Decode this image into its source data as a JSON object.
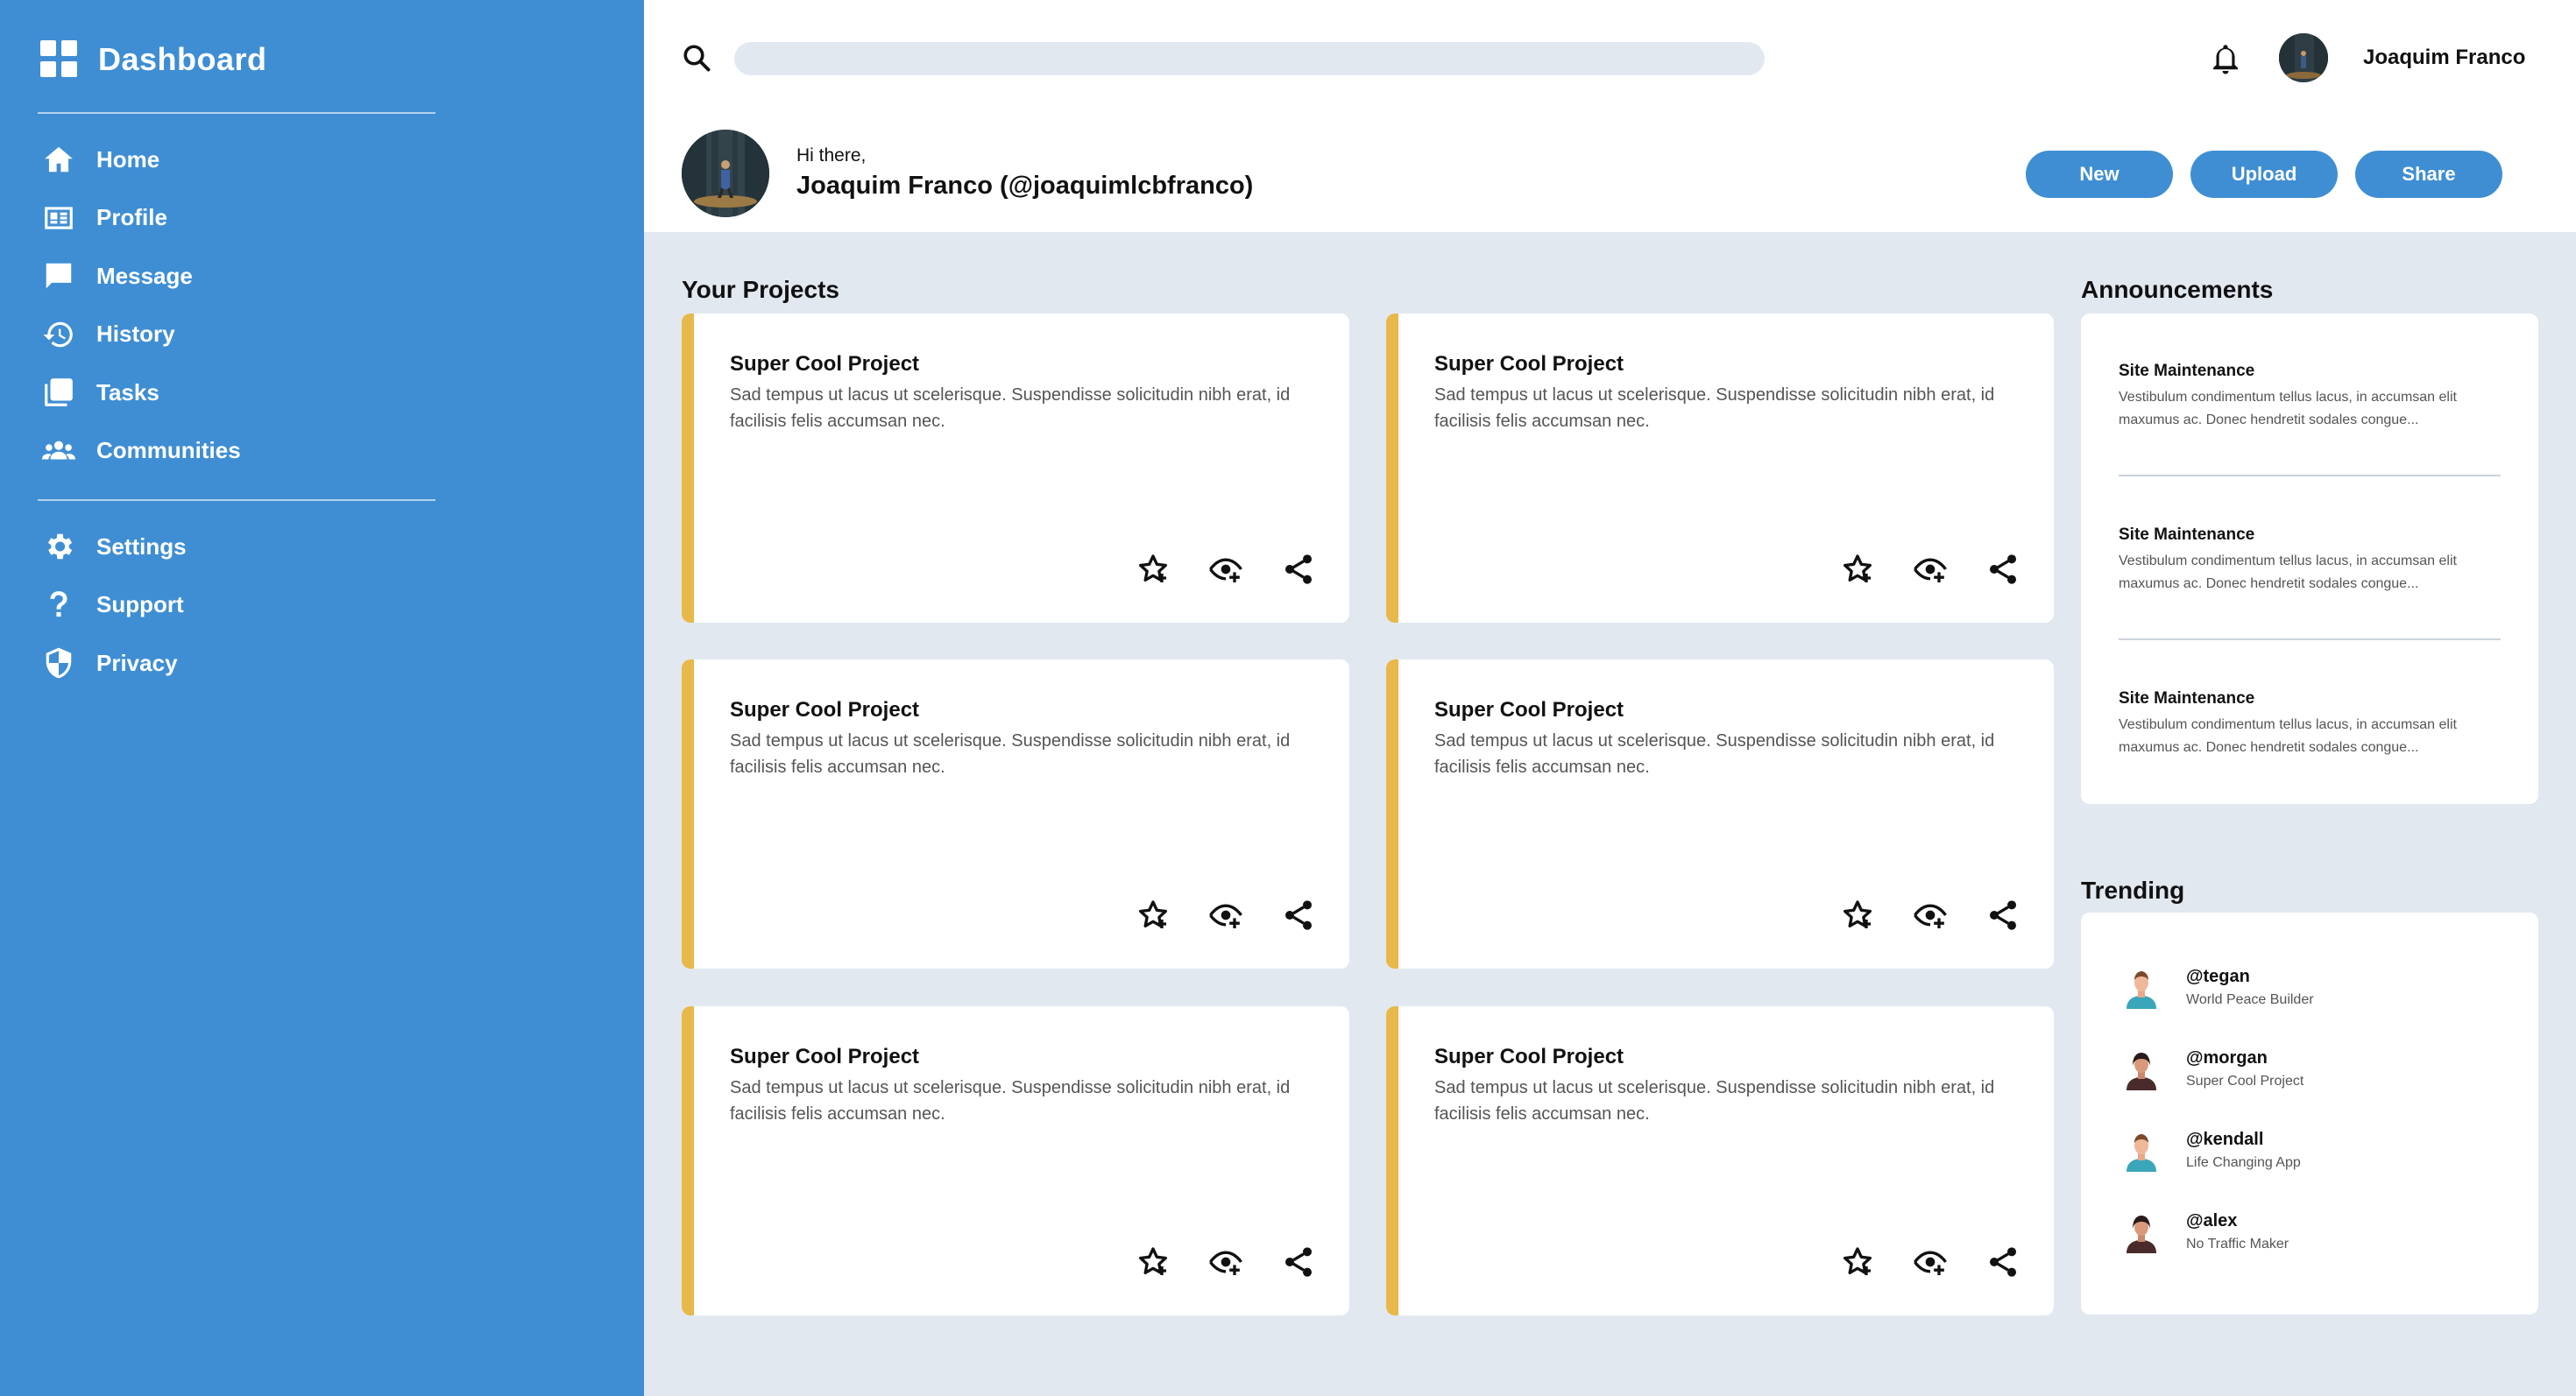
{
  "sidebar": {
    "brand": "Dashboard",
    "nav_primary": [
      {
        "label": "Home",
        "icon": "home-icon"
      },
      {
        "label": "Profile",
        "icon": "id-card-icon"
      },
      {
        "label": "Message",
        "icon": "message-icon"
      },
      {
        "label": "History",
        "icon": "history-icon"
      },
      {
        "label": "Tasks",
        "icon": "tasks-icon"
      },
      {
        "label": "Communities",
        "icon": "communities-icon"
      }
    ],
    "nav_secondary": [
      {
        "label": "Settings",
        "icon": "gear-icon"
      },
      {
        "label": "Support",
        "icon": "question-icon"
      },
      {
        "label": "Privacy",
        "icon": "shield-icon"
      }
    ]
  },
  "header": {
    "search": {
      "placeholder": "",
      "value": ""
    },
    "user_name": "Joaquim Franco",
    "greeting": "Hi there,",
    "full_name": "Joaquim Franco (@joaquimlcbfranco)",
    "buttons": {
      "new": "New",
      "upload": "Upload",
      "share": "Share"
    }
  },
  "projects": {
    "title": "Your Projects",
    "items": [
      {
        "title": "Super Cool Project",
        "description": "Sad tempus ut lacus ut scelerisque. Suspendisse solicitudin nibh erat, id facilisis felis accumsan nec."
      },
      {
        "title": "Super Cool Project",
        "description": "Sad tempus ut lacus ut scelerisque. Suspendisse solicitudin nibh erat, id facilisis felis accumsan nec."
      },
      {
        "title": "Super Cool Project",
        "description": "Sad tempus ut lacus ut scelerisque. Suspendisse solicitudin nibh erat, id facilisis felis accumsan nec."
      },
      {
        "title": "Super Cool Project",
        "description": "Sad tempus ut lacus ut scelerisque. Suspendisse solicitudin nibh erat, id facilisis felis accumsan nec."
      },
      {
        "title": "Super Cool Project",
        "description": "Sad tempus ut lacus ut scelerisque. Suspendisse solicitudin nibh erat, id facilisis felis accumsan nec."
      },
      {
        "title": "Super Cool Project",
        "description": "Sad tempus ut lacus ut scelerisque. Suspendisse solicitudin nibh erat, id facilisis felis accumsan nec."
      }
    ]
  },
  "announcements": {
    "title": "Announcements",
    "items": [
      {
        "title": "Site Maintenance",
        "text": "Vestibulum condimentum tellus lacus, in accumsan elit maxumus ac. Donec hendretit sodales congue..."
      },
      {
        "title": "Site Maintenance",
        "text": "Vestibulum condimentum tellus lacus, in accumsan elit maxumus ac. Donec hendretit sodales congue..."
      },
      {
        "title": "Site Maintenance",
        "text": "Vestibulum condimentum tellus lacus, in accumsan elit maxumus ac. Donec hendretit sodales congue..."
      }
    ]
  },
  "trending": {
    "title": "Trending",
    "items": [
      {
        "handle": "@tegan",
        "subtitle": "World Peace Builder"
      },
      {
        "handle": "@morgan",
        "subtitle": "Super Cool Project"
      },
      {
        "handle": "@kendall",
        "subtitle": "Life Changing App"
      },
      {
        "handle": "@alex",
        "subtitle": "No Traffic Maker"
      }
    ]
  },
  "colors": {
    "sidebar": "#3f8ed3",
    "accent": "#e8b84a",
    "background": "#e2e8f0",
    "card": "#ffffff"
  }
}
